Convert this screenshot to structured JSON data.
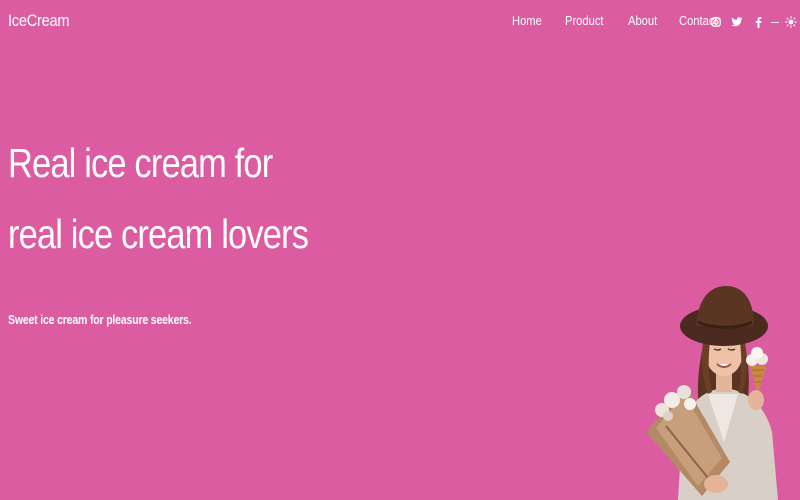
{
  "brand": {
    "logo": "IceCream"
  },
  "nav": {
    "links": [
      "Home",
      "Product",
      "About",
      "Contact"
    ]
  },
  "social": {
    "icons": [
      "instagram-icon",
      "twitter-icon",
      "facebook-icon"
    ],
    "theme_icons": [
      "sun-icon",
      "moon-icon"
    ]
  },
  "hero": {
    "title": "Real ice cream for real ice cream lovers",
    "subtitle": "Sweet ice cream for pleasure seekers."
  },
  "colors": {
    "background": "#dc5ca2",
    "text": "#ffffff"
  }
}
